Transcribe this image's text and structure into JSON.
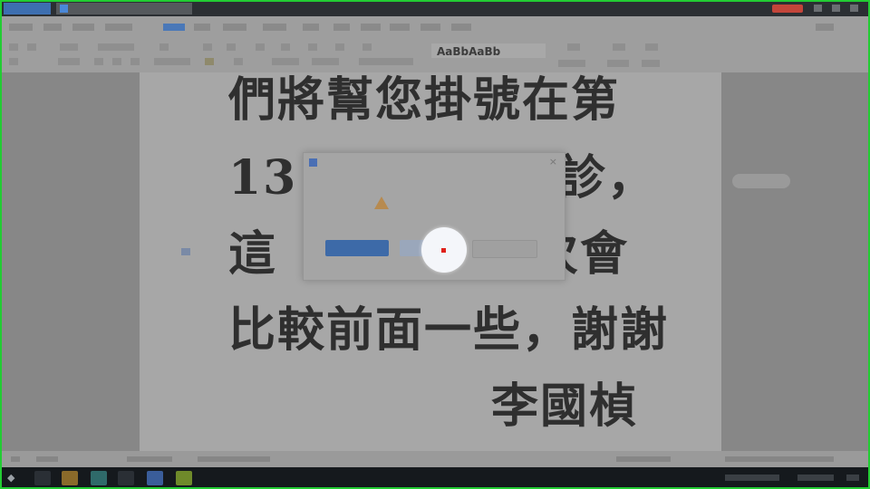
{
  "document": {
    "lines": [
      "們將幫您掛號在第",
      "13",
      "診，",
      "這",
      "次會",
      "比較前面一些，謝謝",
      "李國楨"
    ]
  },
  "ribbon": {
    "style_sample": "AaBbAaBb"
  },
  "colors": {
    "click_marker": "#e0211b",
    "primary_button": "#3d6aa8",
    "highlight_frame": "#22cc33",
    "title_action": "#c3453a"
  },
  "icons": {
    "warning": "warning-icon",
    "close": "close-icon",
    "start": "start-icon"
  }
}
